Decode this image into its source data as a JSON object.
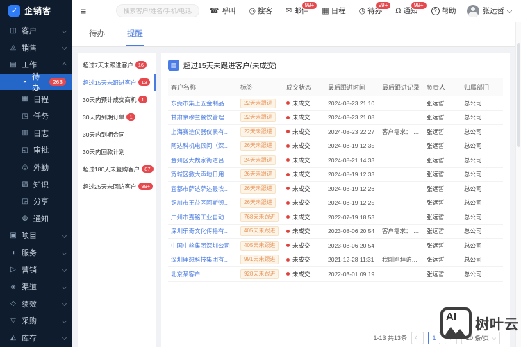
{
  "colors": {
    "accent_blue": "#4a7be0",
    "sidebar_bg": "#0e1c2e",
    "selected_blue": "#2566c9",
    "badge_red": "#e5494d",
    "logo_blue": "#2e7cf6",
    "tag_text": "#e8955a",
    "tag_bg": "#fdf4e8",
    "status_dot": "#e0413c",
    "content_bg": "#f0f2f5",
    "watermark_gray": "#3e3e3e"
  },
  "topbar": {
    "logo_text": "企销客",
    "collapse_glyph": "≡",
    "search_placeholder": "搜索客户/姓名/手机/电话/...",
    "actions": [
      {
        "icon": "phone-icon",
        "glyph": "☎",
        "label": "呼叫",
        "badge": ""
      },
      {
        "icon": "prospect-search-icon",
        "glyph": "◎",
        "label": "搜客",
        "badge": ""
      },
      {
        "icon": "mail-icon",
        "glyph": "✉",
        "label": "邮件",
        "badge": "99+"
      },
      {
        "icon": "calendar-icon",
        "glyph": "▦",
        "label": "日程",
        "badge": ""
      },
      {
        "icon": "clock-icon",
        "glyph": "◷",
        "label": "待办",
        "badge": "99+"
      },
      {
        "icon": "bell-icon",
        "glyph": "Ω",
        "label": "通知",
        "badge": "99+"
      },
      {
        "icon": "help-icon",
        "glyph": "?",
        "label": "帮助",
        "badge": "",
        "circled": true
      }
    ],
    "user_name": "张远哲"
  },
  "sidebar": {
    "items": [
      {
        "label": "客户",
        "icon": "customers-icon",
        "glyph": "◫",
        "chev": true
      },
      {
        "label": "销售",
        "icon": "sales-icon",
        "glyph": "◬",
        "chev": true
      },
      {
        "label": "工作",
        "icon": "work-icon",
        "glyph": "▤",
        "chev": true,
        "expanded": true
      },
      {
        "label": "待办",
        "icon": "todo-icon",
        "glyph": "◔",
        "child": true,
        "selected": true,
        "badge": "263"
      },
      {
        "label": "日程",
        "icon": "schedule-icon",
        "glyph": "▦",
        "child": true
      },
      {
        "label": "任务",
        "icon": "task-icon",
        "glyph": "◳",
        "child": true
      },
      {
        "label": "日志",
        "icon": "journal-icon",
        "glyph": "▥",
        "child": true
      },
      {
        "label": "审批",
        "icon": "approval-icon",
        "glyph": "◱",
        "child": true
      },
      {
        "label": "外勤",
        "icon": "field-work-icon",
        "glyph": "◎",
        "child": true
      },
      {
        "label": "知识",
        "icon": "knowledge-icon",
        "glyph": "▧",
        "child": true
      },
      {
        "label": "分享",
        "icon": "share-icon",
        "glyph": "◲",
        "child": true
      },
      {
        "label": "通知",
        "icon": "notice-icon",
        "glyph": "◍",
        "child": true
      },
      {
        "label": "项目",
        "icon": "project-icon",
        "glyph": "▣",
        "chev": true
      },
      {
        "label": "服务",
        "icon": "service-icon",
        "glyph": "◖",
        "chev": true
      },
      {
        "label": "营销",
        "icon": "marketing-icon",
        "glyph": "▷",
        "chev": true
      },
      {
        "label": "渠道",
        "icon": "channel-icon",
        "glyph": "◈",
        "chev": true
      },
      {
        "label": "绩效",
        "icon": "performance-icon",
        "glyph": "◇",
        "chev": true
      },
      {
        "label": "采购",
        "icon": "procurement-icon",
        "glyph": "▽",
        "chev": true
      },
      {
        "label": "库存",
        "icon": "inventory-icon",
        "glyph": "◭",
        "chev": true
      }
    ]
  },
  "tabs": [
    {
      "label": "待办",
      "active": false
    },
    {
      "label": "提醒",
      "active": true
    }
  ],
  "reminders": [
    {
      "label": "超过7天未跟进客户",
      "badge": "16"
    },
    {
      "label": "超过15天未跟进客户",
      "badge": "13",
      "selected": true
    },
    {
      "label": "30天内预计成交商机",
      "badge": "1"
    },
    {
      "label": "30天内到期订单",
      "badge": "1"
    },
    {
      "label": "30天内到期合同",
      "badge": ""
    },
    {
      "label": "30天内回款计划",
      "badge": ""
    },
    {
      "label": "超过180天未复购客户",
      "badge": "87"
    },
    {
      "label": "超过25天未回访客户",
      "badge": "99+"
    }
  ],
  "table": {
    "title": "超过15天未跟进客户(未成交)",
    "header": [
      {
        "label": "客户名称"
      },
      {
        "label": "标签"
      },
      {
        "label": "成交状态"
      },
      {
        "label": "最后跟进时间"
      },
      {
        "label": "最后跟进记录"
      },
      {
        "label": "负责人"
      },
      {
        "label": "归属部门"
      }
    ],
    "rows": [
      {
        "name": "东莞市集上五金制品有限公司",
        "tag": "22天未跟进",
        "status": "未成交",
        "time": "2024-08-23 21:10",
        "record": "",
        "owner": "张远哲",
        "dept": "总公司"
      },
      {
        "name": "甘肃京穆兰餐饮管理有限公司",
        "tag": "22天未跟进",
        "status": "未成交",
        "time": "2024-08-23 21:08",
        "record": "",
        "owner": "张远哲",
        "dept": "总公司"
      },
      {
        "name": "上海赛途仪器仪表有限公司",
        "tag": "22天未跟进",
        "status": "未成交",
        "time": "2024-08-23 22:27",
        "record": "客户需求： 意向...",
        "owner": "张远哲",
        "dept": "总公司"
      },
      {
        "name": "阿达科机电顾问（深圳）有...",
        "tag": "26天未跟进",
        "status": "未成交",
        "time": "2024-08-19 12:35",
        "record": "",
        "owner": "张远哲",
        "dept": "总公司"
      },
      {
        "name": "金州区大魏家街道吕忠声出...",
        "tag": "24天未跟进",
        "status": "未成交",
        "time": "2024-08-21 14:33",
        "record": "",
        "owner": "张远哲",
        "dept": "总公司"
      },
      {
        "name": "宽城区撒大声地日用品百货...",
        "tag": "26天未跟进",
        "status": "未成交",
        "time": "2024-08-19 12:33",
        "record": "",
        "owner": "张远哲",
        "dept": "总公司"
      },
      {
        "name": "宜都市萨达萨达最农业厂",
        "tag": "26天未跟进",
        "status": "未成交",
        "time": "2024-08-19 12:26",
        "record": "",
        "owner": "张远哲",
        "dept": "总公司"
      },
      {
        "name": "铜川市王益区阿斯顿英语学校",
        "tag": "26天未跟进",
        "status": "未成交",
        "time": "2024-08-19 12:25",
        "record": "",
        "owner": "张远哲",
        "dept": "总公司"
      },
      {
        "name": "广州市嘉铭工业自动化技术...",
        "tag": "768天未跟进",
        "status": "未成交",
        "time": "2022-07-19 18:53",
        "record": "",
        "owner": "张远哲",
        "dept": "总公司"
      },
      {
        "name": "深圳乐奇文化传播有限公司",
        "tag": "405天未跟进",
        "status": "未成交",
        "time": "2023-08-06 20:54",
        "record": "客户需求： 意向...",
        "owner": "张远哲",
        "dept": "总公司"
      },
      {
        "name": "中国中丝集团深圳公司",
        "tag": "405天未跟进",
        "status": "未成交",
        "time": "2023-08-06 20:54",
        "record": "",
        "owner": "张远哲",
        "dept": "总公司"
      },
      {
        "name": "深圳理想科技集团有限公司",
        "tag": "991天未跟进",
        "status": "未成交",
        "time": "2021-12-28 11:31",
        "record": "我刚刚拜访了这...",
        "owner": "张远哲",
        "dept": "总公司"
      },
      {
        "name": "北京某客户",
        "tag": "928天未跟进",
        "status": "未成交",
        "time": "2022-03-01 09:19",
        "record": "",
        "owner": "张远哲",
        "dept": "总公司"
      }
    ]
  },
  "pagination": {
    "range": "1-13 共13条",
    "page": "1",
    "size": "20 条/页"
  },
  "watermark": {
    "ai_label": "AI",
    "text": "树叶云"
  }
}
